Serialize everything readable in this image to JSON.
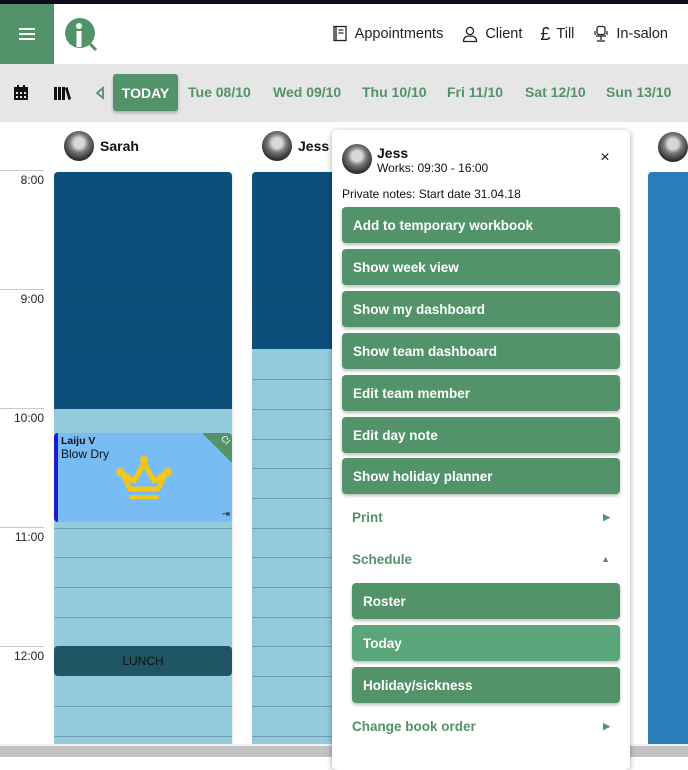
{
  "header": {
    "menu_icon": "hamburger-icon",
    "logo": "iQ",
    "nav": [
      {
        "label": "Appointments",
        "icon": "appointment-book-icon"
      },
      {
        "label": "Client",
        "icon": "person-icon"
      },
      {
        "label": "Till",
        "icon": "pound-icon"
      },
      {
        "label": "In-salon",
        "icon": "salon-chair-icon"
      }
    ]
  },
  "datebar": {
    "today_label": "TODAY",
    "days": [
      "Tue 08/10",
      "Wed 09/10",
      "Thu 10/10",
      "Fri 11/10",
      "Sat 12/10",
      "Sun 13/10"
    ]
  },
  "calendar": {
    "times": [
      "8:00",
      "9:00",
      "10:00",
      "11:00",
      "12:00"
    ],
    "staff": [
      {
        "name": "Sarah"
      },
      {
        "name": "Jess"
      },
      {
        "name": ""
      }
    ],
    "appointment": {
      "client": "Laiju V",
      "service": "Blow Dry",
      "corner_badge": "CI",
      "checkin_icon": "⇥"
    },
    "lunch_label": "LUNCH"
  },
  "popup": {
    "name": "Jess",
    "works": "Works: 09:30 - 16:00",
    "notes": "Private notes: Start date 31.04.18",
    "close": "×",
    "buttons": [
      "Add to temporary workbook",
      "Show week view",
      "Show my dashboard",
      "Show team dashboard",
      "Edit team member",
      "Edit day note",
      "Show holiday planner"
    ],
    "print_label": "Print",
    "schedule_label": "Schedule",
    "schedule_items": [
      "Roster",
      "Today",
      "Holiday/sickness"
    ],
    "change_book_order_label": "Change book order",
    "chevron_right": "▶",
    "chevron_up": "▲"
  },
  "colors": {
    "brand_green": "#52936a",
    "closed_time": "#0d4f7b",
    "open_time": "#93cbdd",
    "appointment": "#78bcf4",
    "lunch": "#1f5565"
  }
}
